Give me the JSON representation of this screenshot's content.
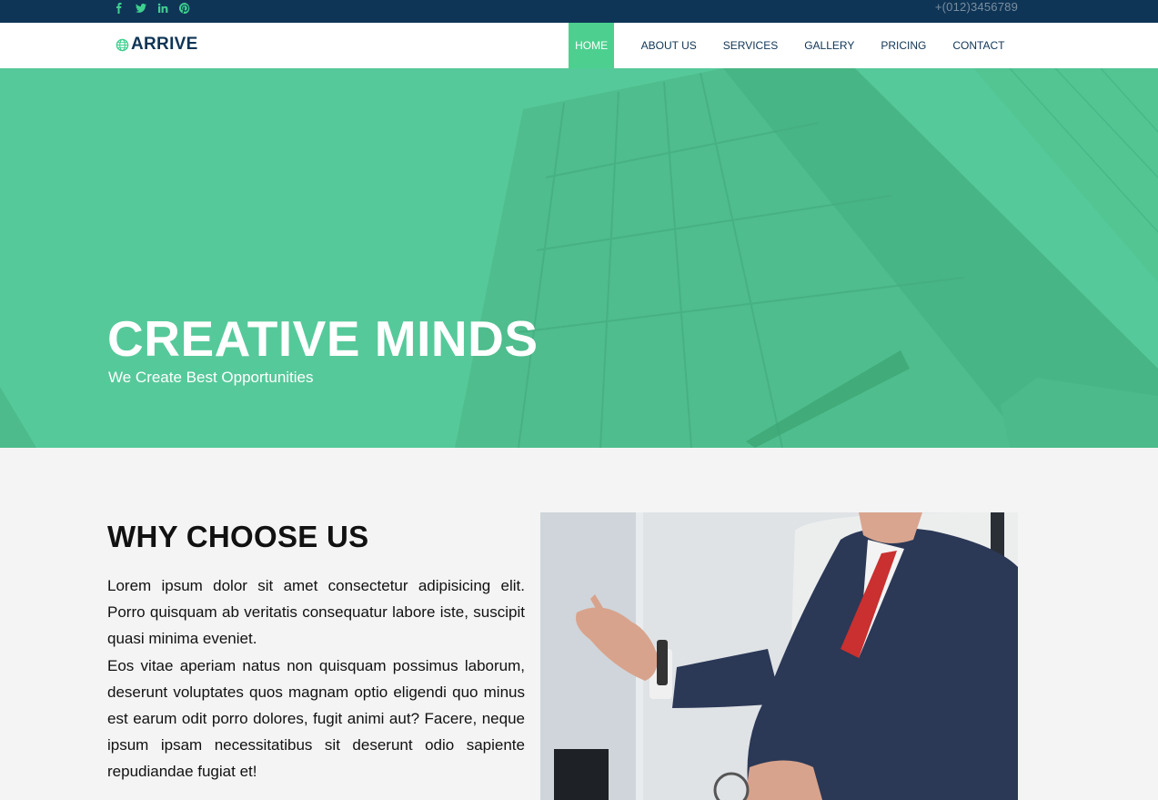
{
  "topbar": {
    "social": [
      {
        "icon": "facebook-icon"
      },
      {
        "icon": "twitter-icon"
      },
      {
        "icon": "linkedin-icon"
      },
      {
        "icon": "pinterest-icon"
      }
    ],
    "phone": "+(012)3456789"
  },
  "brand": {
    "name": "ARRIVE",
    "icon": "globe-icon"
  },
  "nav": {
    "items": [
      "HOME",
      "ABOUT US",
      "SERVICES",
      "GALLERY",
      "PRICING",
      "CONTACT"
    ],
    "active": "HOME"
  },
  "hero": {
    "title": "CREATIVE MINDS",
    "subtitle": "We Create Best Opportunities"
  },
  "why": {
    "title": "WHY CHOOSE US",
    "paragraphs": [
      "Lorem ipsum dolor sit amet consectetur adipisicing elit. Porro quisquam ab veritatis consequatur labore iste, suscipit quasi minima eveniet.",
      "Eos vitae aperiam natus non quisquam possimus laborum, deserunt voluptates quos magnam optio eligendi quo minus est earum odit porro dolores, fugit animi aut? Facere, neque ipsum ipsam necessitatibus sit deserunt odio sapiente repudiandae fugiat et!"
    ]
  },
  "colors": {
    "topbar": "#0f3556",
    "accent": "#4dd08f",
    "hero_overlay": "#57cb9a",
    "text_dark": "#0f3556"
  }
}
